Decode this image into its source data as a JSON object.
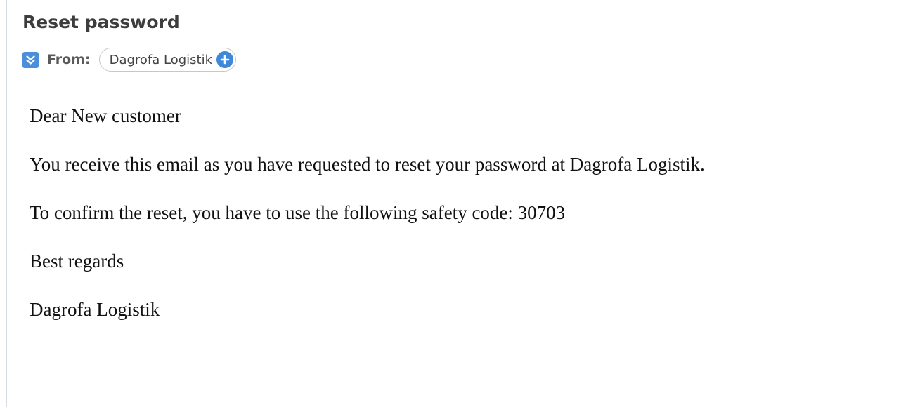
{
  "message": {
    "subject": "Reset password",
    "from_label": "From:",
    "sender_name": "Dagrofa Logistik",
    "body": {
      "greeting": "Dear New customer",
      "paragraph_1": "You receive this email as you have requested to reset your password at Dagrofa Logistik.",
      "paragraph_2": "To confirm the reset, you have to use the following safety code: 30703",
      "closing": "Best regards",
      "signature": "Dagrofa Logistik"
    }
  },
  "icons": {
    "expand": "chevron-double-down-icon",
    "add_contact": "plus-circle-icon"
  },
  "colors": {
    "accent": "#4b8fdc",
    "divider": "#cdd3dd"
  }
}
